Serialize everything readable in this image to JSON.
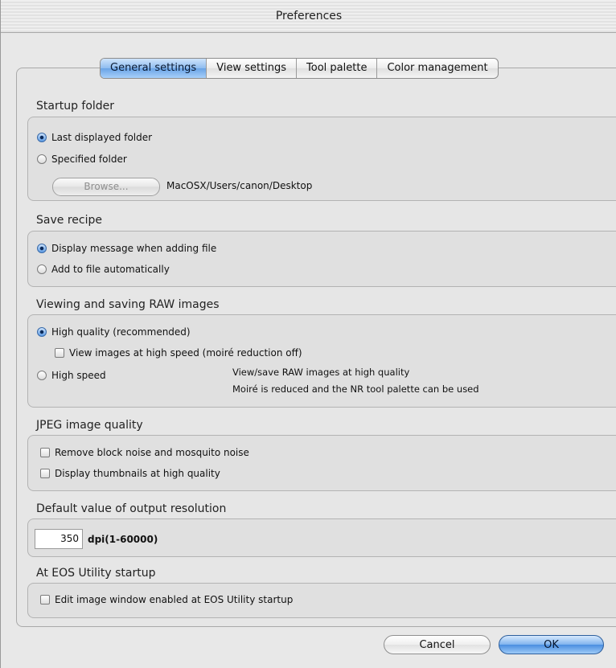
{
  "window": {
    "title": "Preferences"
  },
  "tabs": [
    {
      "label": "General settings",
      "selected": true
    },
    {
      "label": "View settings",
      "selected": false
    },
    {
      "label": "Tool palette",
      "selected": false
    },
    {
      "label": "Color management",
      "selected": false
    }
  ],
  "startup_folder": {
    "title": "Startup folder",
    "options": [
      {
        "label": "Last displayed folder",
        "selected": true
      },
      {
        "label": "Specified folder",
        "selected": false
      }
    ],
    "browse_label": "Browse...",
    "path": "MacOSX/Users/canon/Desktop"
  },
  "save_recipe": {
    "title": "Save recipe",
    "options": [
      {
        "label": "Display message when adding file",
        "selected": true
      },
      {
        "label": "Add to file automatically",
        "selected": false
      }
    ]
  },
  "raw_images": {
    "title": "Viewing and saving RAW images",
    "high_quality_label": "High quality (recommended)",
    "high_quality_selected": true,
    "view_high_speed_label": "View images at high speed (moiré reduction off)",
    "view_high_speed_checked": false,
    "high_speed_label": "High speed",
    "high_speed_selected": false,
    "note_line1": "View/save RAW images at high quality",
    "note_line2": "Moiré is reduced and the NR tool palette can be used"
  },
  "jpeg_quality": {
    "title": "JPEG image quality",
    "options": [
      {
        "label": "Remove block noise and mosquito noise",
        "checked": false
      },
      {
        "label": "Display thumbnails at high quality",
        "checked": false
      }
    ]
  },
  "output_resolution": {
    "title": "Default value of output resolution",
    "value": "350",
    "unit_label": "dpi(1-60000)"
  },
  "eos_utility": {
    "title": "At EOS Utility startup",
    "option_label": "Edit image window enabled at EOS Utility startup",
    "checked": false
  },
  "buttons": {
    "cancel": "Cancel",
    "ok": "OK"
  },
  "colors": {
    "accent": "#6aa3e6",
    "background": "#e8e8e8"
  }
}
